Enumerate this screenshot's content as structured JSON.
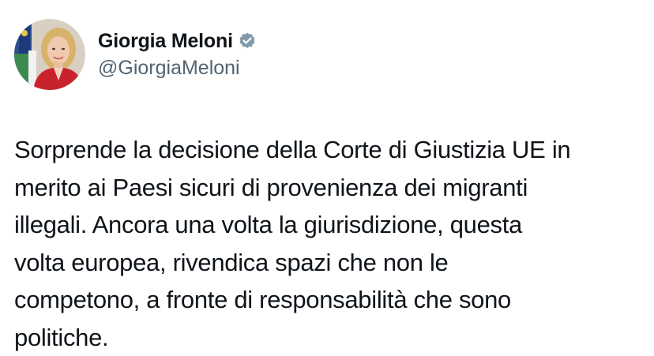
{
  "author": {
    "display_name": "Giorgia Meloni",
    "handle": "@GiorgiaMeloni",
    "verified_icon": "verified-badge-icon",
    "verified_color": "#829aab"
  },
  "tweet": {
    "text": "Sorprende la decisione della Corte di Giustizia UE in\nmerito ai Paesi sicuri di provenienza dei migranti\nillegali. Ancora una volta la giurisdizione, questa\nvolta europea, rivendica spazi che non le\ncompetono, a fronte di responsabilità che sono\npolitiche."
  },
  "colors": {
    "text": "#0f1419",
    "secondary_text": "#536471",
    "background": "#ffffff"
  }
}
